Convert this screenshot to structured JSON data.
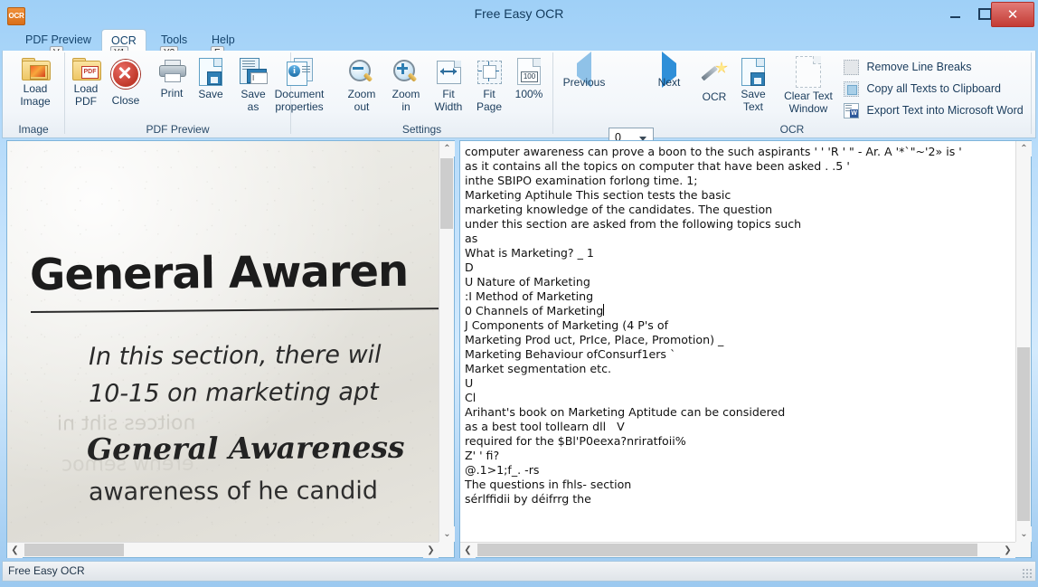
{
  "window": {
    "title": "Free Easy OCR",
    "app_icon": "OCR",
    "minimize": "minimize-icon",
    "maximize": "maximize-icon",
    "close": "✕"
  },
  "tabs": [
    {
      "label": "PDF Preview",
      "keytip": "V",
      "active": false
    },
    {
      "label": "OCR",
      "keytip": "Y1",
      "active": true
    },
    {
      "label": "Tools",
      "keytip": "Y2",
      "active": false
    },
    {
      "label": "Help",
      "keytip": "E",
      "active": false
    }
  ],
  "ribbon": {
    "groups": [
      {
        "label": "Image"
      },
      {
        "label": "PDF Preview"
      },
      {
        "label": "Settings"
      },
      {
        "label": "OCR"
      }
    ],
    "buttons": {
      "load_image": "Load\nImage",
      "load_image_l1": "Load",
      "load_image_l2": "Image",
      "load_pdf_l1": "Load",
      "load_pdf_l2": "PDF",
      "close": "Close",
      "print": "Print",
      "save": "Save",
      "save_as_l1": "Save",
      "save_as_l2": "as",
      "doc_props_l1": "Document",
      "doc_props_l2": "properties",
      "zoom_out_l1": "Zoom",
      "zoom_out_l2": "out",
      "zoom_in_l1": "Zoom",
      "zoom_in_l2": "in",
      "fit_width_l1": "Fit",
      "fit_width_l2": "Width",
      "fit_page_l1": "Fit",
      "fit_page_l2": "Page",
      "zoom_100": "100%",
      "zoom_100_badge": "100",
      "previous": "Previous",
      "next": "Next",
      "ocr": "OCR",
      "save_text_l1": "Save",
      "save_text_l2": "Text",
      "clear_text_l1": "Clear Text",
      "clear_text_l2": "Window",
      "remove_line_breaks": "Remove Line Breaks",
      "copy_all_texts": "Copy all Texts to Clipboard",
      "export_word": "Export Text into Microsoft Word"
    },
    "page_selector": {
      "value": "0"
    }
  },
  "image_pane": {
    "scan": {
      "heading": "General Awaren",
      "line1": "In this section, there wil",
      "line2": "10-15  on marketing apt",
      "line3": "General Awareness",
      "line4": "awareness  of he candid",
      "ghost1": "noitces siht ni",
      "ghost2": "erehw semoc"
    }
  },
  "text_pane": {
    "lines": [
      "computer awareness can prove a boon to the such aspirants ' ' 'R ' \" - Ar. A '*`\"~'2» is '",
      "as it contains all the topics on computer that have been asked . .5 '",
      "inthe SBIPO examination forlong time. 1;",
      "Marketing Aptihule This section tests the basic",
      "marketing knowledge of the candidates. The question",
      "under this section are asked from the following topics such",
      "as",
      "What is Marketing? _ 1",
      "D",
      "U Nature of Marketing",
      ":I Method of Marketing",
      "0 Channels of Marketing",
      "J Components of Marketing (4 P's of",
      "Marketing Prod uct, PrIce, Place, Promotion) _",
      "Marketing Behaviour ofConsurf1ers `",
      "Market segmentation etc.",
      "U",
      "Cl",
      "Arihant's book on Marketing Aptitude can be considered",
      "as a best tool tollearn dll   V",
      "required for the $Bl'P0eexa?nriratfoii%",
      "Z' ' fi?",
      "@.1>1;f_. -rs",
      "The questions in fhls- section",
      "sérlffidii by déifrrg the"
    ],
    "caret_line_index": 11
  },
  "statusbar": {
    "text": "Free Easy OCR"
  },
  "scrollbars": {
    "up_glyph": "⌃",
    "down_glyph": "⌄",
    "left_glyph": "❮",
    "right_glyph": "❯"
  }
}
